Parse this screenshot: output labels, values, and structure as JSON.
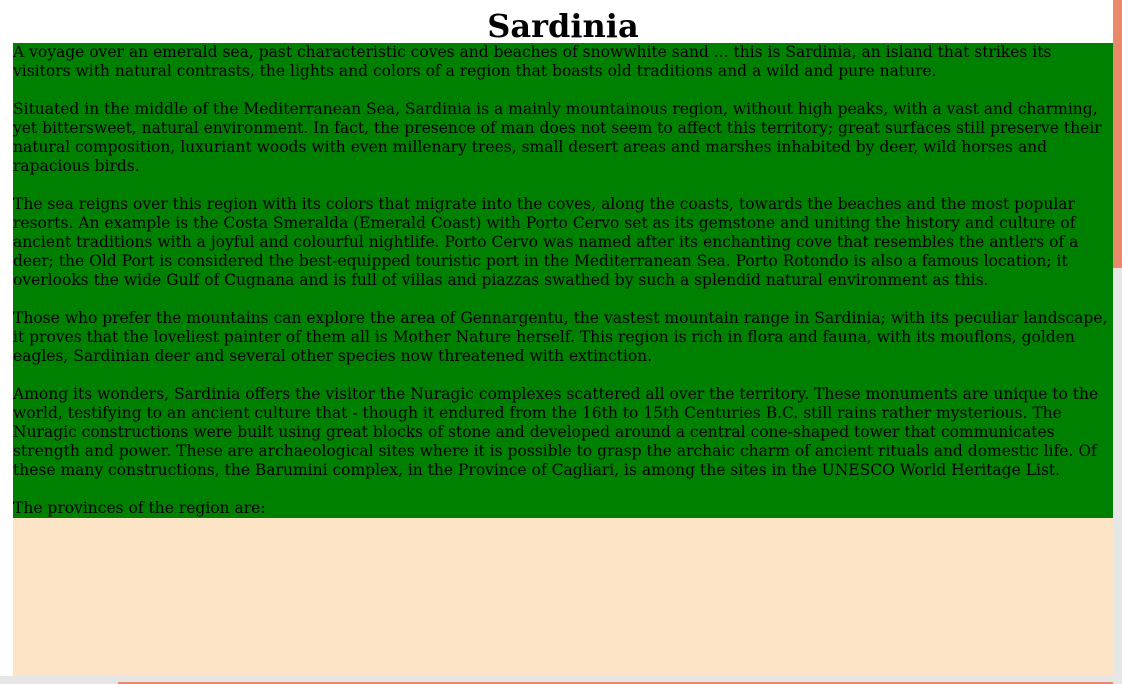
{
  "page": {
    "title": "Sardinia"
  },
  "content": {
    "paragraphs": [
      "A voyage over an emerald sea, past characteristic coves and beaches of snowwhite sand ... this is Sardinia, an island that strikes its visitors with natural contrasts, the lights and colors of a region that boasts old traditions and a wild and pure nature.",
      "Situated in the middle of the Mediterranean Sea, Sardinia is a mainly mountainous region, without high peaks, with a vast and charming, yet bittersweet, natural environment. In fact, the presence of man does not seem to affect this territory; great surfaces still preserve their natural composition, luxuriant woods with even millenary trees, small desert areas and marshes inhabited by deer, wild horses and rapacious birds.",
      "The sea reigns over this region with its colors that migrate into the coves, along the coasts, towards the beaches and the most popular resorts. An example is the Costa Smeralda (Emerald Coast) with Porto Cervo set as its gemstone and uniting the history and culture of ancient traditions with a joyful and colourful nightlife. Porto Cervo was named after its enchanting cove that resembles the antlers of a deer; the Old Port is considered the best-equipped touristic port in the Mediterranean Sea. Porto Rotondo is also a famous location; it overlooks the wide Gulf of Cugnana and is full of villas and piazzas swathed by such a splendid natural environment as this.",
      "Those who prefer the mountains can explore the area of Gennargentu, the vastest mountain range in Sardinia; with its peculiar landscape, it proves that the loveliest painter of them all is Mother Nature herself. This region is rich in flora and fauna, with its mouflons, golden eagles, Sardinian deer and several other species now threatened with extinction.",
      "Among its wonders, Sardinia offers the visitor the Nuragic complexes scattered all over the territory. These monuments are unique to the world, testifying to an ancient culture that - though it endured from the 16th to 15th Centuries B.C. still rains rather mysterious. The Nuragic constructions were built using great blocks of stone and developed around a central cone-shaped tower that communicates strength and power. These are archaeological sites where it is possible to grasp the archaic charm of ancient rituals and domestic life. Of these many constructions, the Barumini complex, in the Province of Cagliari, is among the sites in the UNESCO World Heritage List.",
      "The provinces of the region are:"
    ]
  },
  "colors": {
    "content_background": "#008000",
    "lower_panel_background": "#fde4c6",
    "scrollbar_thumb": "#e8896a",
    "scrollbar_track": "#e6e6e6"
  }
}
